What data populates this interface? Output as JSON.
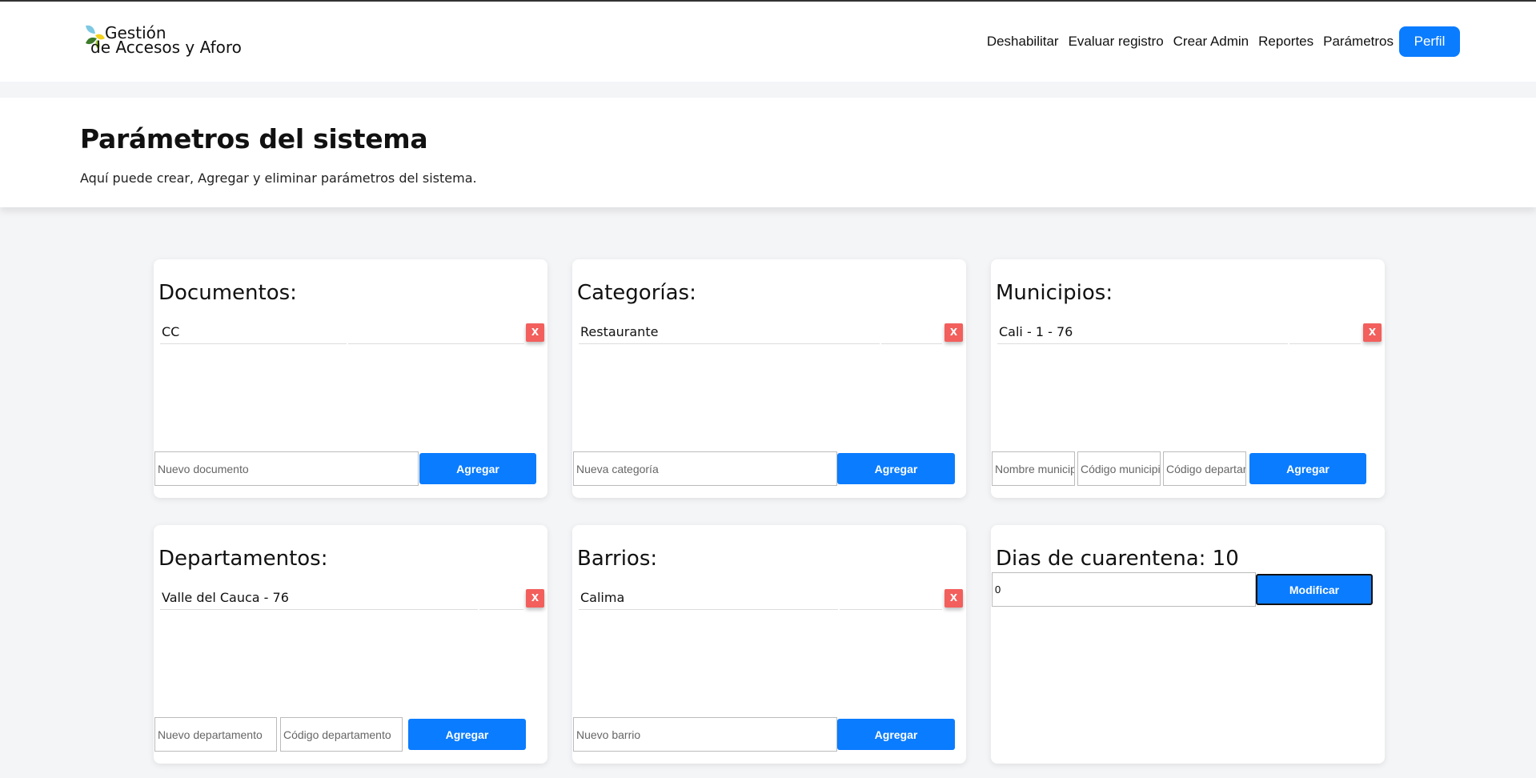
{
  "brand": {
    "line1": "Gestión",
    "line2": "de Accesos y Aforo"
  },
  "nav": {
    "links": [
      "Deshabilitar",
      "Evaluar registro",
      "Crear Admin",
      "Reportes",
      "Parámetros"
    ],
    "profile_label": "Perfil"
  },
  "header": {
    "title": "Parámetros del sistema",
    "description": "Aquí puede crear, Agregar y eliminar parámetros del sistema."
  },
  "cards": {
    "documentos": {
      "title": "Documentos:",
      "item": "CC",
      "delete_label": "X",
      "input_placeholder": "Nuevo documento",
      "add_label": "Agregar"
    },
    "categorias": {
      "title": "Categorías:",
      "item": "Restaurante",
      "delete_label": "X",
      "input_placeholder": "Nueva categoría",
      "add_label": "Agregar"
    },
    "municipios": {
      "title": "Municipios:",
      "item": "Cali - 1 - 76",
      "delete_label": "X",
      "input_placeholder_1": "Nombre municipio",
      "input_placeholder_2": "Código municipio",
      "input_placeholder_3": "Código departamento",
      "add_label": "Agregar"
    },
    "departamentos": {
      "title": "Departamentos:",
      "item": "Valle del Cauca - 76",
      "delete_label": "X",
      "input_placeholder_1": "Nuevo departamento",
      "input_placeholder_2": "Código departamento",
      "add_label": "Agregar"
    },
    "barrios": {
      "title": "Barrios:",
      "item": "Calima",
      "delete_label": "X",
      "input_placeholder": "Nuevo barrio",
      "add_label": "Agregar"
    },
    "cuarentena": {
      "title": "Dias de cuarentena: 10",
      "input_value": "0",
      "modify_label": "Modificar"
    }
  },
  "colors": {
    "accent": "#0a7cff",
    "delete": "#f25f5c"
  }
}
